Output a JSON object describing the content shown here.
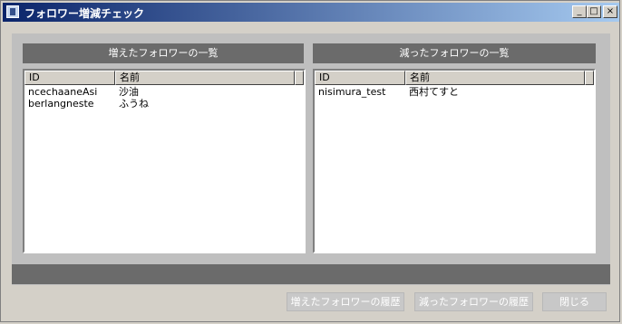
{
  "window": {
    "title": "フォロワー増減チェック",
    "min_glyph": "_",
    "max_glyph": "□",
    "close_glyph": "×"
  },
  "left_panel": {
    "header": "増えたフォロワーの一覧",
    "columns": [
      "ID",
      "名前"
    ],
    "rows": [
      {
        "id": "ncechaaneAsi",
        "name": "沙油"
      },
      {
        "id": "berlangneste",
        "name": "ふうね"
      }
    ]
  },
  "right_panel": {
    "header": "減ったフォロワーの一覧",
    "columns": [
      "ID",
      "名前"
    ],
    "rows": [
      {
        "id": "nisimura_test",
        "name": "西村てすと"
      }
    ]
  },
  "buttons": {
    "increase_history": "増えたフォロワーの履歴",
    "decrease_history": "減ったフォロワーの履歴",
    "close": "閉じる"
  }
}
